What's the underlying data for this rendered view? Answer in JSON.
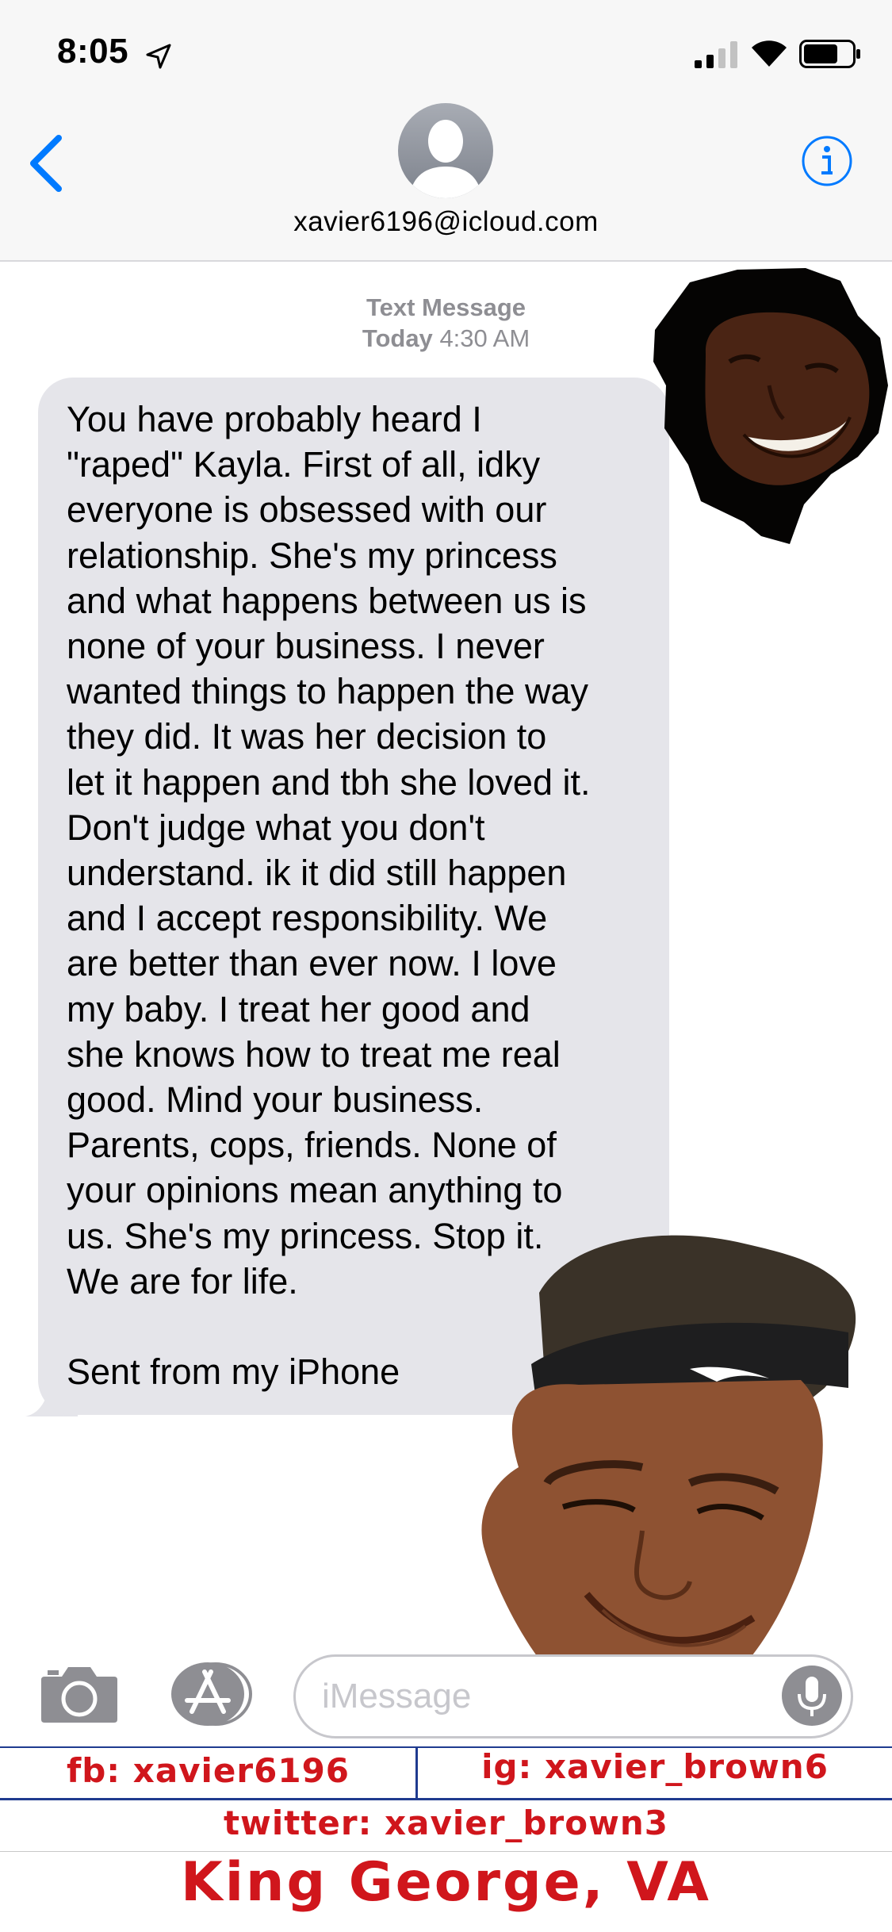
{
  "status_bar": {
    "time": "8:05",
    "icons": [
      "location-arrow-icon",
      "cellular-signal-icon",
      "wifi-icon",
      "battery-icon"
    ]
  },
  "header": {
    "back_icon": "chevron-left-icon",
    "avatar_icon": "person-silhouette-icon",
    "contact": "xavier6196@icloud.com",
    "info_icon": "info-icon"
  },
  "thread": {
    "service": "Text Message",
    "day": "Today",
    "time": "4:30 AM",
    "message": "You have probably heard I\n\"raped\" Kayla. First of all, idky\neveryone is obsessed with our\nrelationship. She's my princess\nand what happens between us is\nnone of your business. I never\nwanted things to happen the way\nthey did. It was her decision to\nlet it happen and tbh she loved it.\nDon't judge what you don't\nunderstand. ik it did still happen\nand I accept responsibility. We\nare better than ever now. I love\nmy baby. I treat her good and\nshe knows how to treat me real\ngood. Mind your business.\nParents, cops, friends. None of\nyour opinions mean anything to\nus. She's my princess. Stop it.\nWe are for life.\n\nSent from my iPhone"
  },
  "input_bar": {
    "placeholder": "iMessage",
    "icons": [
      "camera-icon",
      "app-store-icon",
      "microphone-icon"
    ]
  },
  "caption": {
    "fb": "fb: xavier6196",
    "ig": "ig: xavier_brown6",
    "twitter": "twitter: xavier_brown3",
    "location": "King George, VA"
  },
  "colors": {
    "ios_blue": "#007aff",
    "bubble_gray": "#e5e5ea",
    "caption_red": "#d0161c",
    "caption_rule": "#1f3b8f"
  }
}
